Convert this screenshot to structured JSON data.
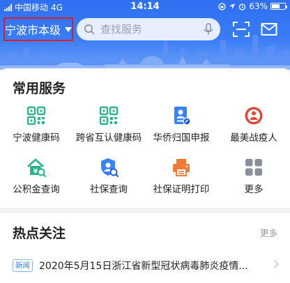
{
  "status_bar": {
    "carrier": "中国移动",
    "network": "4G",
    "time": "14:14",
    "battery": "63%",
    "battery_level": 0.63
  },
  "header": {
    "city_label": "宁波市本级",
    "search_placeholder": "查找服务"
  },
  "services": {
    "title": "常用服务",
    "items": [
      {
        "label": "宁波健康码",
        "icon": "qr-code-icon"
      },
      {
        "label": "跨省互认健康码",
        "icon": "qr-code-icon"
      },
      {
        "label": "华侨归国申报",
        "icon": "id-card-icon"
      },
      {
        "label": "最美战疫人",
        "icon": "medal-icon"
      },
      {
        "label": "公积金查询",
        "icon": "house-fund-icon"
      },
      {
        "label": "社保查询",
        "icon": "social-security-icon"
      },
      {
        "label": "社保证明打印",
        "icon": "printer-icon"
      },
      {
        "label": "更多",
        "icon": "more-grid-icon"
      }
    ]
  },
  "hot_topics": {
    "title": "热点关注",
    "more_label": "更多",
    "news": [
      {
        "tag": "新闻",
        "title": "2020年5月15日浙江省新型冠状病毒肺炎疫情..."
      }
    ]
  },
  "colors": {
    "header_blue": "#3a7cf6",
    "highlight_red": "#d81e2c",
    "green": "#2bb389",
    "blue": "#3a82f7",
    "red": "#e0473a",
    "orange": "#f07c3a",
    "gray": "#8a8f99"
  }
}
